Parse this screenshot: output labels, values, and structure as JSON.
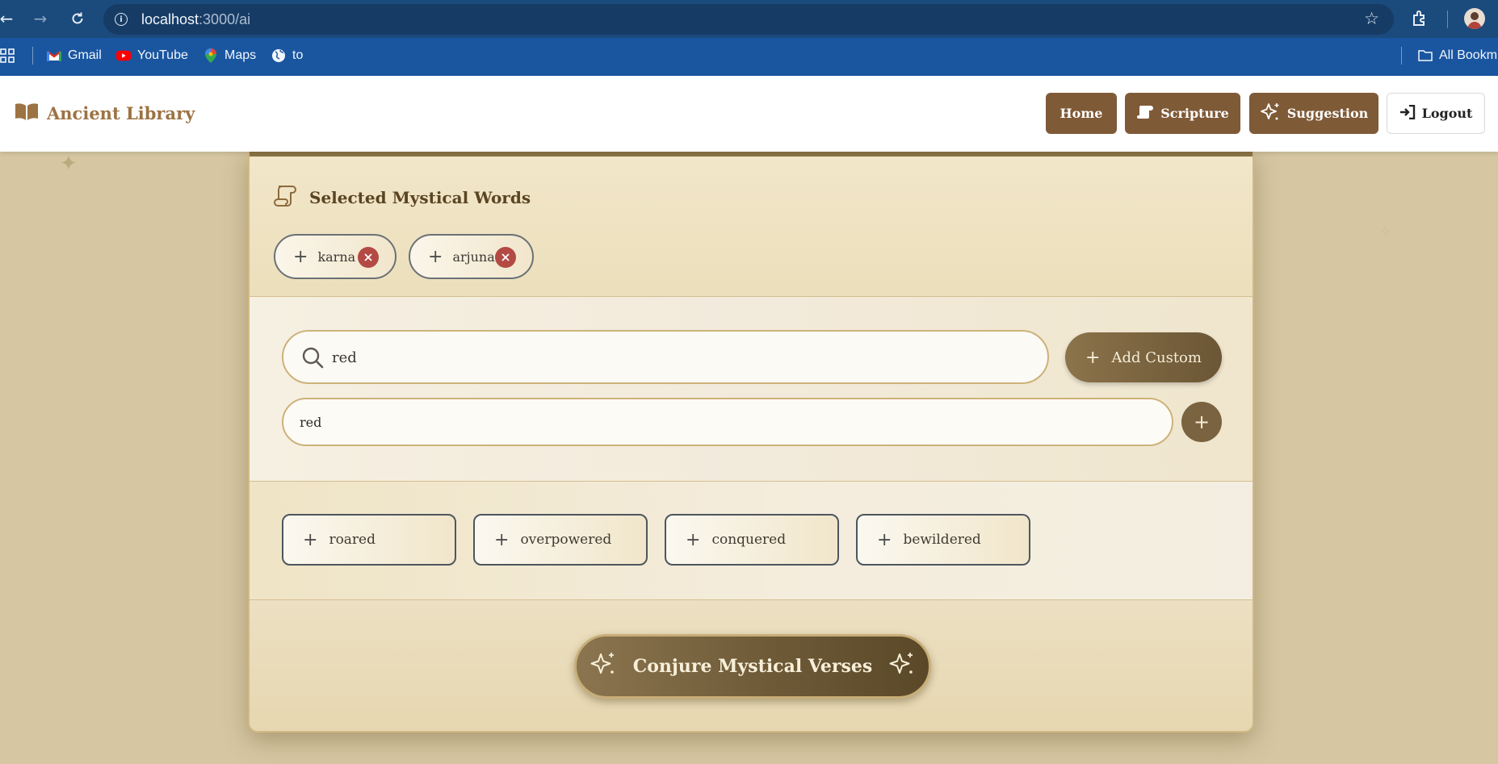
{
  "browser": {
    "url_host": "localhost",
    "url_path": ":3000/ai",
    "bookmarks": [
      {
        "label": "Gmail",
        "icon": "gmail-icon"
      },
      {
        "label": "YouTube",
        "icon": "youtube-icon"
      },
      {
        "label": "Maps",
        "icon": "maps-icon"
      },
      {
        "label": "to",
        "icon": "globe-icon"
      }
    ],
    "all_bookmarks_label": "All Bookm"
  },
  "header": {
    "brand": "Ancient Library",
    "nav": {
      "home": "Home",
      "scripture": "Scripture",
      "suggestion": "Suggestion",
      "logout": "Logout"
    }
  },
  "selected": {
    "title": "Selected Mystical Words",
    "words": [
      "karna",
      "arjuna"
    ]
  },
  "search": {
    "value": "red",
    "add_custom_label": "Add Custom",
    "custom_value": "red"
  },
  "suggestions": [
    "roared",
    "overpowered",
    "conquered",
    "bewildered"
  ],
  "action": {
    "conjure_label": "Conjure Mystical Verses"
  },
  "colors": {
    "accent_brown": "#7f5a37",
    "chip_remove": "#b34a44",
    "chrome_blue": "#1b4a7c",
    "bookmarks_blue": "#1a56a0"
  }
}
